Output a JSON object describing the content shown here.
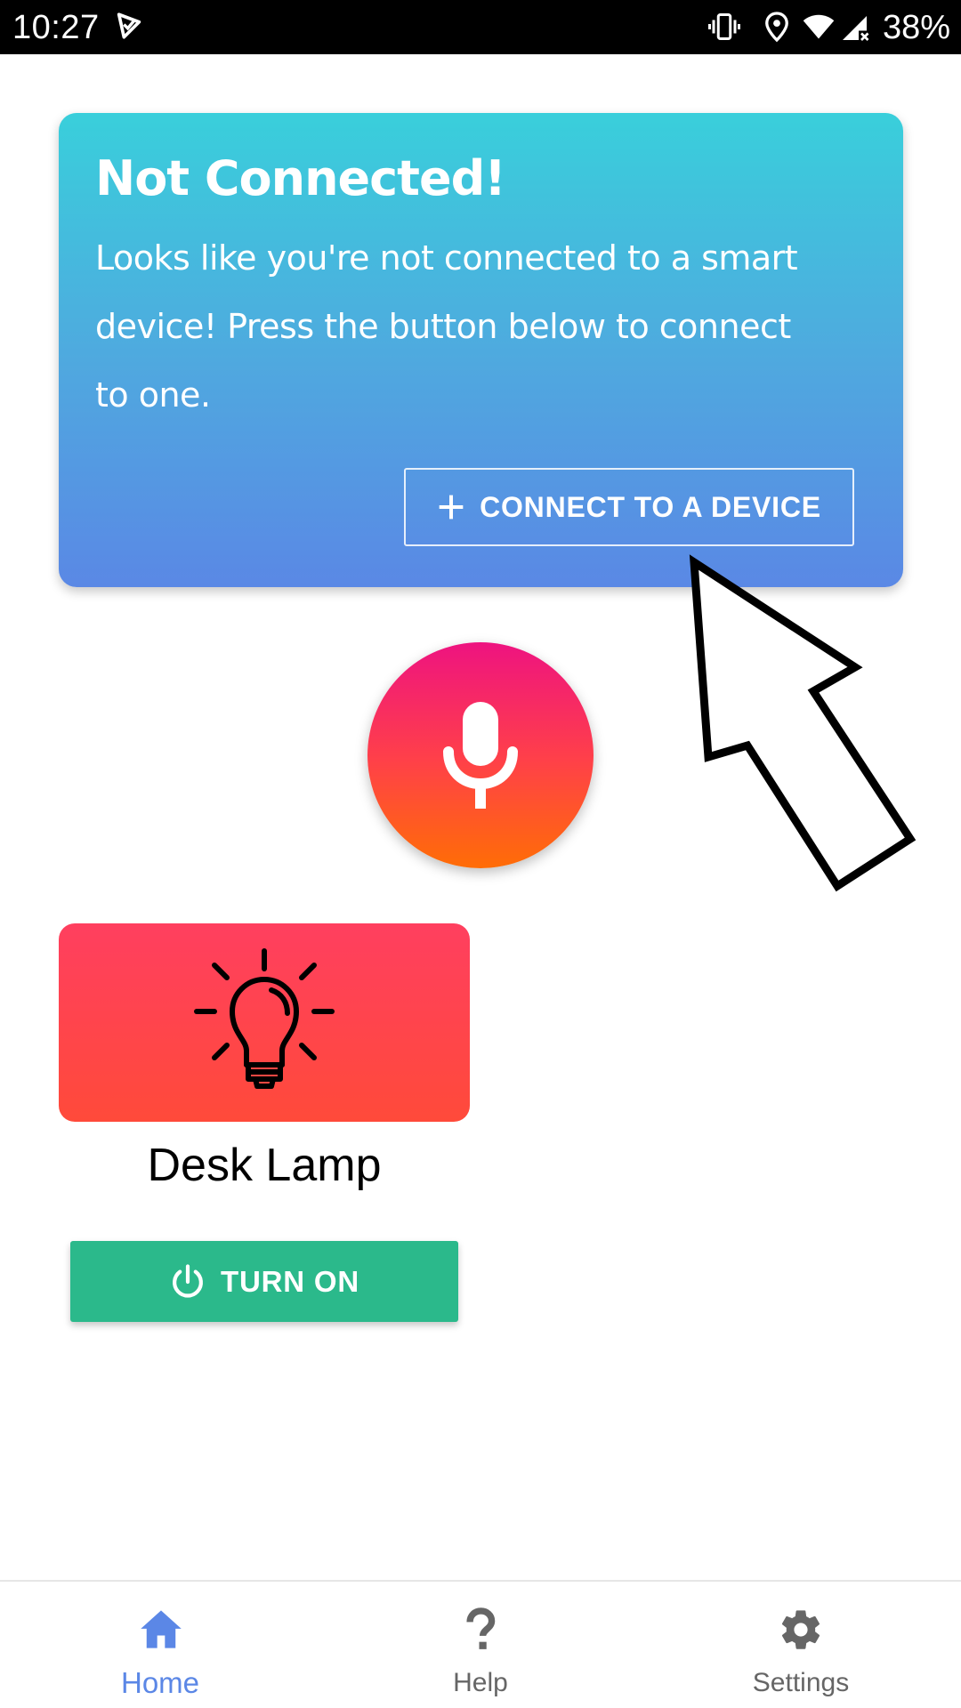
{
  "status_bar": {
    "time": "10:27",
    "battery": "38%",
    "icons": [
      "notification-check-icon",
      "vibrate-icon",
      "location-icon",
      "wifi-icon",
      "cellular-signal-icon"
    ]
  },
  "connect_card": {
    "title": "Not Connected!",
    "message": "Looks like you're not connected to a smart device! Press the button below to connect to one.",
    "button_label": "CONNECT TO A DEVICE",
    "button_icon": "plus-icon"
  },
  "mic_button": {
    "icon": "microphone-icon"
  },
  "device": {
    "name": "Desk Lamp",
    "icon": "lightbulb-icon",
    "button_label": "TURN ON",
    "button_icon": "power-icon"
  },
  "bottom_nav": {
    "items": [
      {
        "label": "Home",
        "icon": "home-icon",
        "active": true
      },
      {
        "label": "Help",
        "icon": "help-icon",
        "active": false
      },
      {
        "label": "Settings",
        "icon": "settings-icon",
        "active": false
      }
    ]
  },
  "colors": {
    "active_nav": "#5b87e6",
    "inactive_nav": "#666666",
    "turn_on_button": "#2bb98b",
    "card_gradient_top": "#39cfdb",
    "card_gradient_bottom": "#5a88e5",
    "mic_gradient_top": "#ee1380",
    "mic_gradient_bottom": "#ff6d06",
    "lamp_tile": "#ff4457"
  }
}
